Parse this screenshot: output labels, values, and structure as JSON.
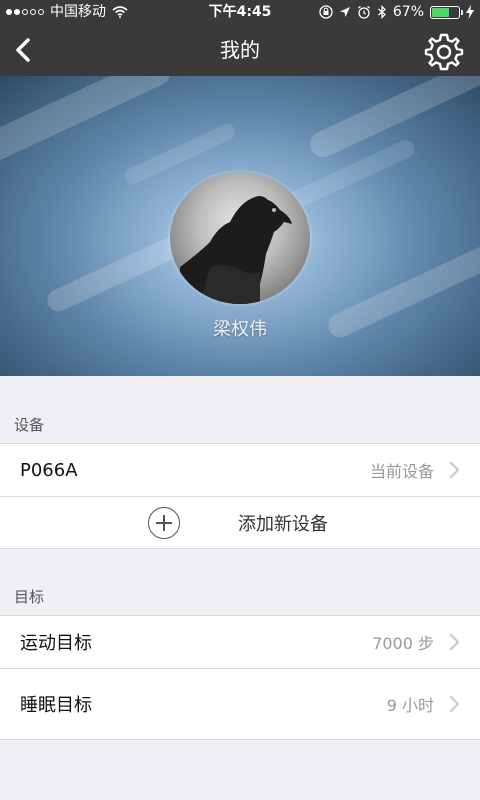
{
  "status_bar": {
    "carrier": "中国移动",
    "time": "下午4:45",
    "battery_percent": "67%",
    "battery_level": 0.67,
    "signal_bars_on": 2,
    "signal_bars_total": 5
  },
  "nav": {
    "title": "我的",
    "back_icon": "chevron-left-icon",
    "settings_icon": "gear-icon"
  },
  "profile": {
    "username": "梁权伟"
  },
  "devices": {
    "section_label": "设备",
    "items": [
      {
        "label": "P066A",
        "value": "当前设备"
      }
    ],
    "add_label": "添加新设备"
  },
  "goals": {
    "section_label": "目标",
    "items": [
      {
        "label": "运动目标",
        "value": "7000 步"
      },
      {
        "label": "睡眠目标",
        "value": "9 小时"
      }
    ]
  },
  "colors": {
    "topbar": "#3a3a3a",
    "background": "#efeff4",
    "battery_fill": "#4cd964",
    "value_text": "#9a9a9a"
  }
}
